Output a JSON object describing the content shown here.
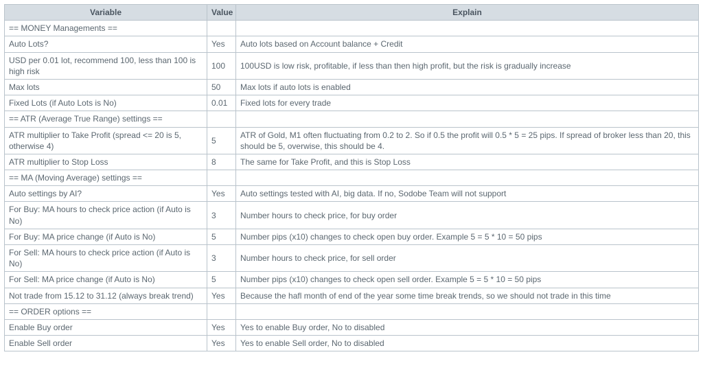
{
  "headers": {
    "variable": "Variable",
    "value": "Value",
    "explain": "Explain"
  },
  "rows": [
    {
      "variable": "== MONEY Managements ==",
      "value": "",
      "explain": ""
    },
    {
      "variable": "Auto Lots?",
      "value": "Yes",
      "explain": "Auto lots based on Account balance + Credit"
    },
    {
      "variable": "USD per 0.01 lot, recommend 100, less than 100 is high risk",
      "value": "100",
      "explain": "100USD is low risk, profitable, if less than then high profit, but the risk is gradually increase"
    },
    {
      "variable": "Max lots",
      "value": "50",
      "explain": "Max lots if auto lots is enabled"
    },
    {
      "variable": "Fixed Lots (if Auto Lots is No)",
      "value": "0.01",
      "explain": "Fixed lots for every trade"
    },
    {
      "variable": "== ATR (Average True Range) settings ==",
      "value": "",
      "explain": ""
    },
    {
      "variable": "ATR multiplier to Take Profit (spread <= 20 is 5, otherwise 4)",
      "value": "5",
      "explain": "ATR of Gold, M1 often fluctuating from 0.2 to 2. So if 0.5 the profit will 0.5 * 5 = 25 pips. If spread of broker less than 20, this should be 5, overwise, this should be 4."
    },
    {
      "variable": "ATR multiplier to Stop Loss",
      "value": "8",
      "explain": "The same for Take Profit, and this is Stop Loss"
    },
    {
      "variable": "== MA (Moving Average) settings ==",
      "value": "",
      "explain": ""
    },
    {
      "variable": "Auto settings by AI?",
      "value": "Yes",
      "explain": "Auto settings tested with AI, big data. If no, Sodobe Team will not support"
    },
    {
      "variable": " For Buy: MA hours to check price action (if Auto is No)",
      "value": "3",
      "explain": "Number hours to check price, for buy order"
    },
    {
      "variable": " For Buy: MA price change (if Auto is No)",
      "value": "5",
      "explain": "Number pips (x10) changes to check open buy order. Example 5 = 5 * 10 = 50 pips"
    },
    {
      "variable": " For Sell: MA hours to check price action (if Auto is No)",
      "value": "3",
      "explain": "Number hours to check price, for sell order"
    },
    {
      "variable": " For Sell: MA price change (if Auto is No)",
      "value": "5",
      "explain": "Number pips (x10) changes to check open sell order. Example 5 = 5 * 10 = 50 pips"
    },
    {
      "variable": " Not trade from 15.12 to 31.12 (always break trend)",
      "value": "Yes",
      "explain": "Because the hafl month of end of the year some time break trends, so we should not trade in this time"
    },
    {
      "variable": "== ORDER options ==",
      "value": "",
      "explain": ""
    },
    {
      "variable": "Enable Buy order",
      "value": "Yes",
      "explain": "Yes to enable Buy order, No to disabled"
    },
    {
      "variable": "Enable Sell order",
      "value": "Yes",
      "explain": "Yes to enable Sell order, No to disabled"
    }
  ]
}
